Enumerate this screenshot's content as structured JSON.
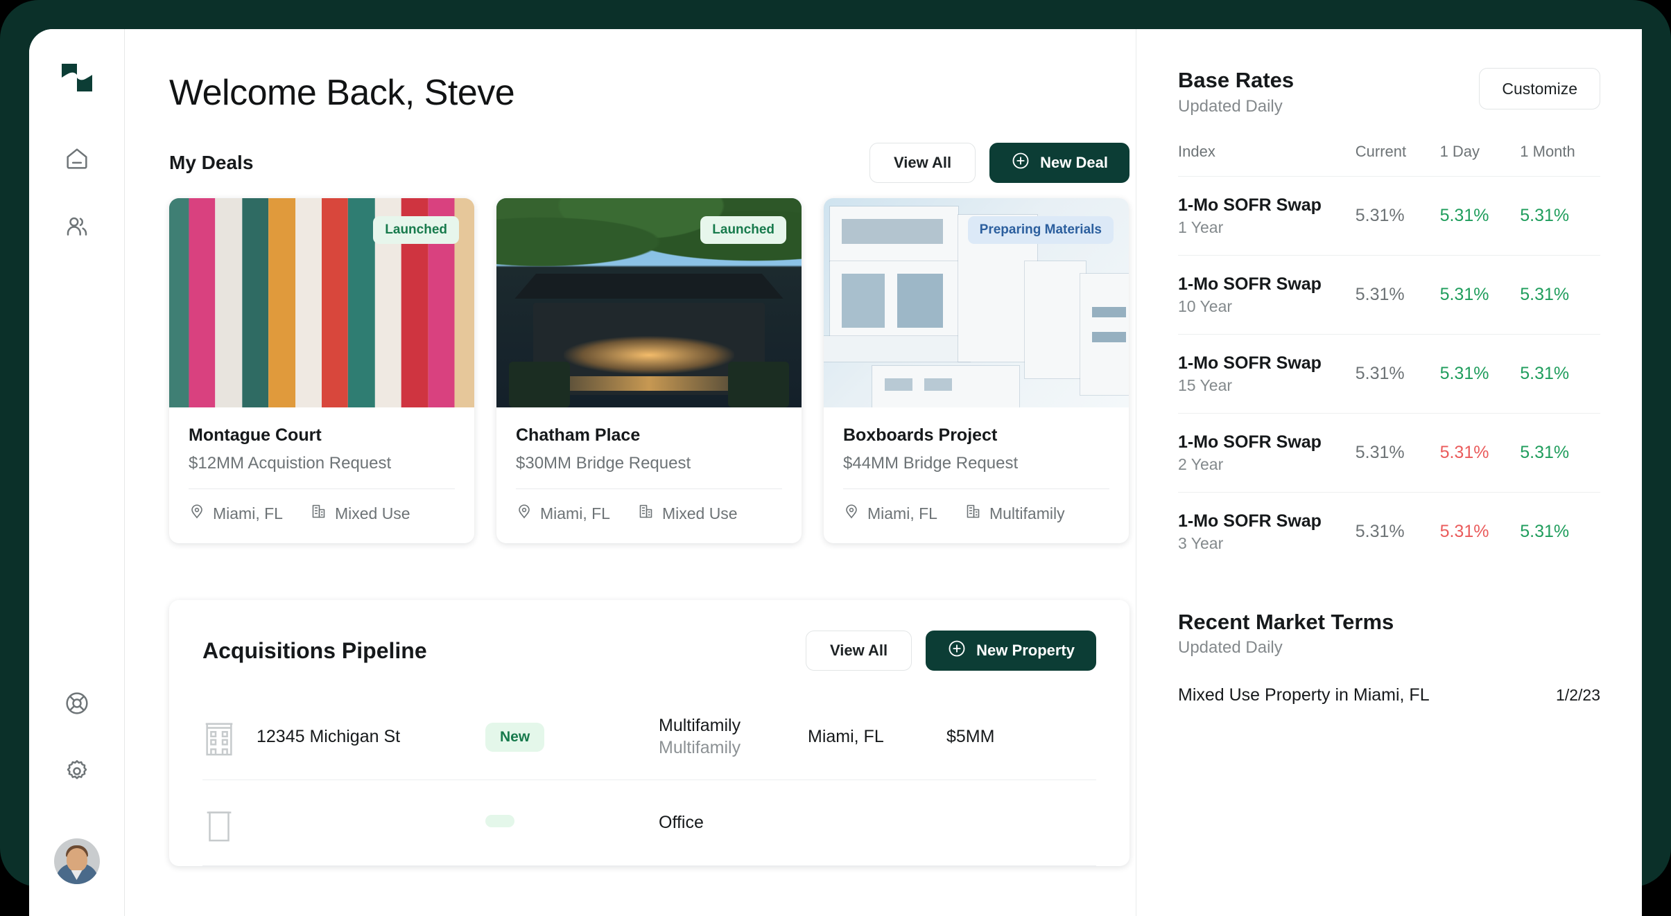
{
  "brand": {
    "logo_icon": "stepped-squares-logo",
    "primary_color": "#0c3d35",
    "shell_color": "#0b3029"
  },
  "sidebar": {
    "items": [
      {
        "icon": "home-icon",
        "name": "home"
      },
      {
        "icon": "users-icon",
        "name": "clients"
      }
    ],
    "bottom_items": [
      {
        "icon": "lifebuoy-icon",
        "name": "support"
      },
      {
        "icon": "gear-icon",
        "name": "settings"
      }
    ],
    "avatar_alt": "Steve"
  },
  "header": {
    "title": "Welcome Back, Steve"
  },
  "deals_section": {
    "title": "My Deals",
    "view_all_label": "View All",
    "new_deal_label": "New Deal",
    "new_deal_icon": "plus-circle-icon",
    "cards": [
      {
        "badge": "Launched",
        "badge_type": "launched",
        "name": "Montague Court",
        "request": "$12MM Acquistion Request",
        "location": "Miami, FL",
        "asset_type": "Mixed Use",
        "image": "colorful-striped-facade"
      },
      {
        "badge": "Launched",
        "badge_type": "launched",
        "name": "Chatham Place",
        "request": "$30MM Bridge Request",
        "location": "Miami, FL",
        "asset_type": "Mixed Use",
        "image": "illuminated-modern-house-at-dusk"
      },
      {
        "badge": "Preparing Materials",
        "badge_type": "preparing",
        "name": "Boxboards Project",
        "request": "$44MM Bridge Request",
        "location": "Miami, FL",
        "asset_type": "Multifamily",
        "image": "white-modern-office-building"
      }
    ]
  },
  "pipeline": {
    "title": "Acquisitions Pipeline",
    "view_all_label": "View All",
    "new_property_label": "New Property",
    "new_property_icon": "plus-circle-icon",
    "rows": [
      {
        "address": "12345 Michigan St",
        "status": "New",
        "type_primary": "Multifamily",
        "type_secondary": "Multifamily",
        "location": "Miami, FL",
        "amount": "$5MM"
      },
      {
        "address": "",
        "status": "",
        "type_primary": "Office",
        "type_secondary": "",
        "location": "",
        "amount": ""
      }
    ]
  },
  "base_rates": {
    "title": "Base Rates",
    "subtitle": "Updated Daily",
    "customize_label": "Customize",
    "columns": [
      "Index",
      "Current",
      "1 Day",
      "1 Month"
    ],
    "rows": [
      {
        "index": "1-Mo SOFR Swap",
        "term": "1 Year",
        "current": "5.31%",
        "day": "5.31%",
        "day_dir": "up",
        "month": "5.31%",
        "month_dir": "up"
      },
      {
        "index": "1-Mo SOFR Swap",
        "term": "10 Year",
        "current": "5.31%",
        "day": "5.31%",
        "day_dir": "up",
        "month": "5.31%",
        "month_dir": "up"
      },
      {
        "index": "1-Mo SOFR Swap",
        "term": "15 Year",
        "current": "5.31%",
        "day": "5.31%",
        "day_dir": "up",
        "month": "5.31%",
        "month_dir": "up"
      },
      {
        "index": "1-Mo SOFR Swap",
        "term": "2 Year",
        "current": "5.31%",
        "day": "5.31%",
        "day_dir": "down",
        "month": "5.31%",
        "month_dir": "up"
      },
      {
        "index": "1-Mo SOFR Swap",
        "term": "3 Year",
        "current": "5.31%",
        "day": "5.31%",
        "day_dir": "down",
        "month": "5.31%",
        "month_dir": "up"
      }
    ],
    "up_color": "#1f9d5c",
    "down_color": "#ea5b5b"
  },
  "market_terms": {
    "title": "Recent Market Terms",
    "subtitle": "Updated Daily",
    "rows": [
      {
        "label": "Mixed Use Property in Miami, FL",
        "date": "1/2/23"
      }
    ]
  }
}
